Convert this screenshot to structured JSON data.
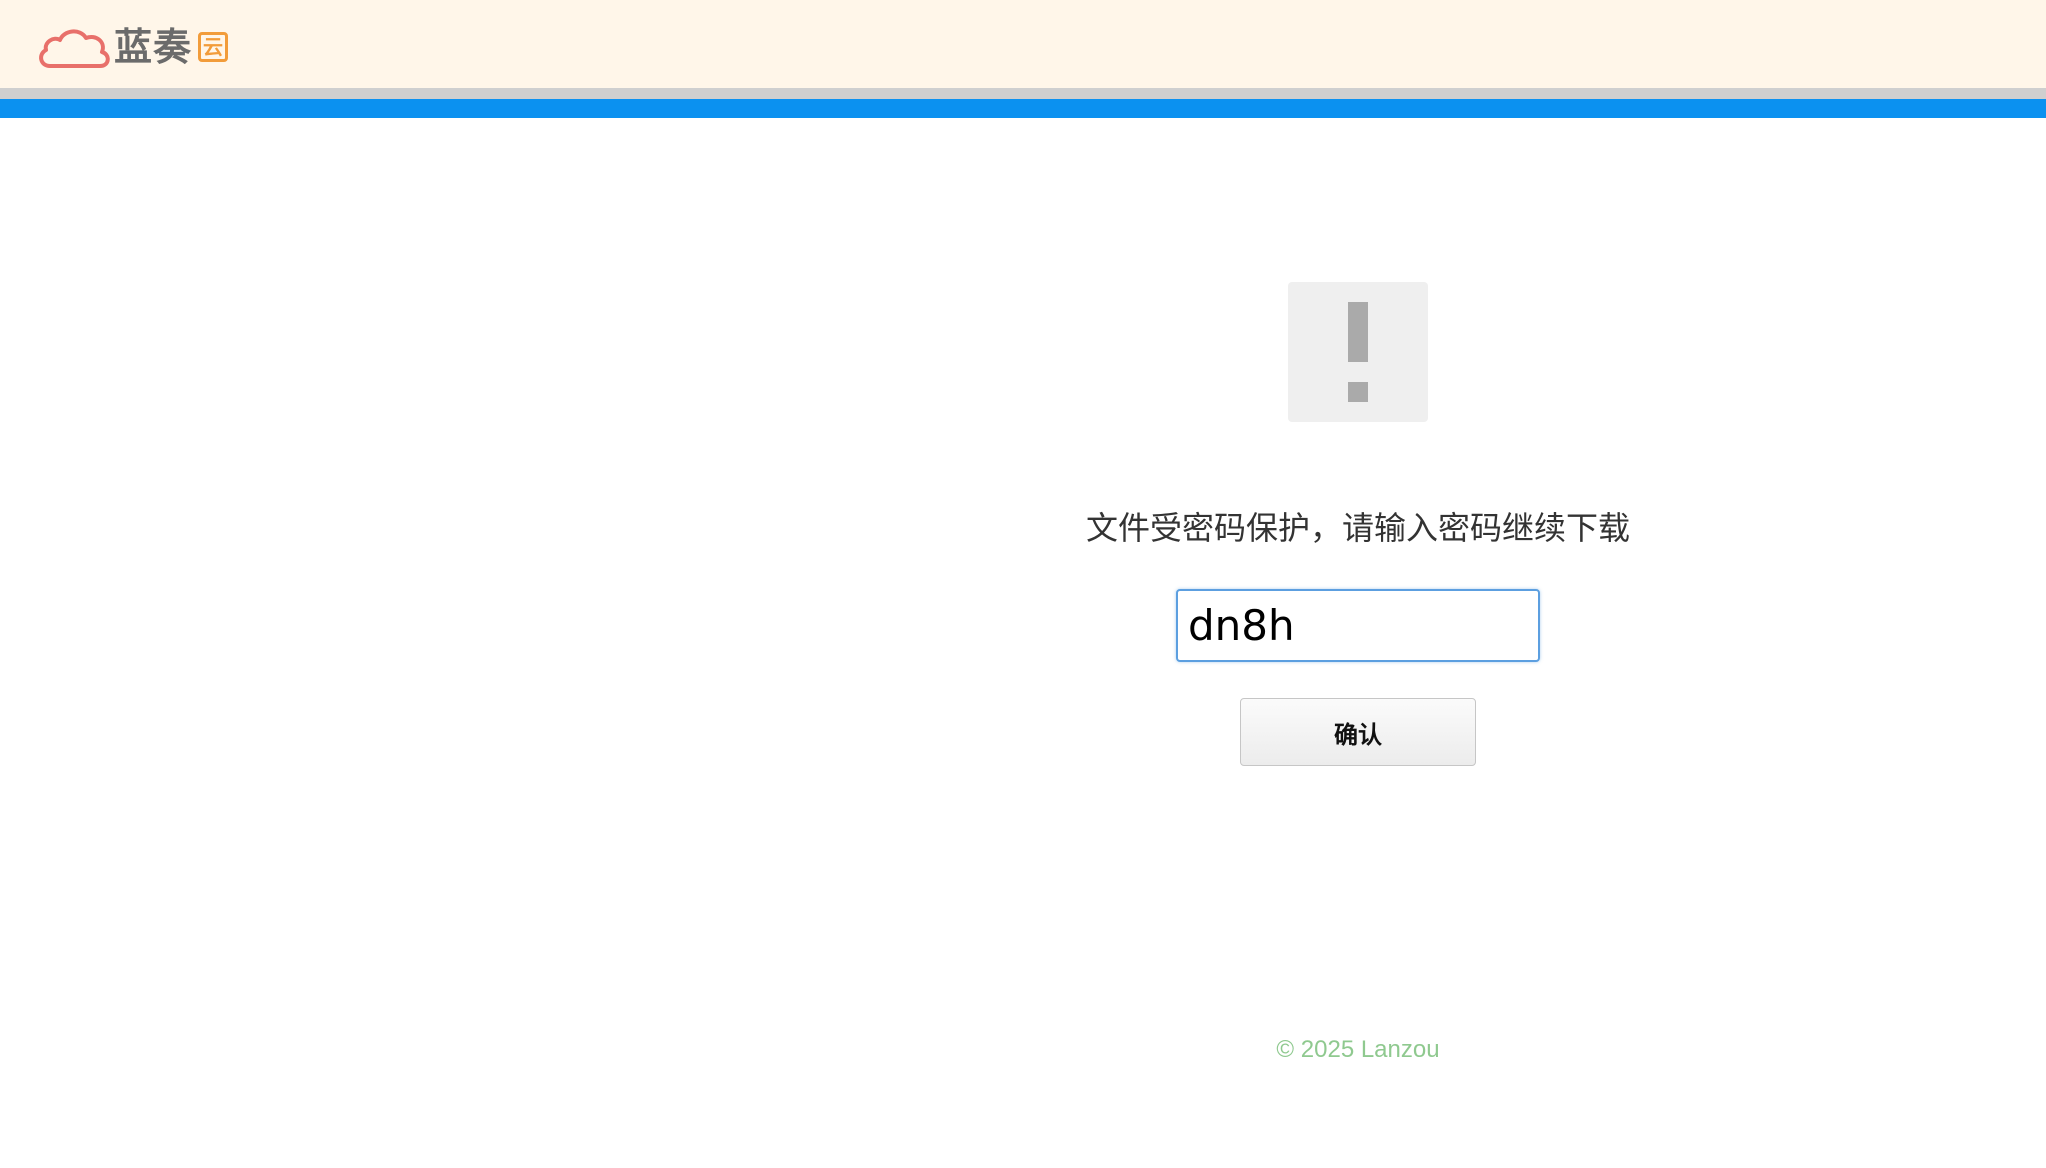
{
  "header": {
    "logo_text": "蓝奏",
    "logo_badge": "云",
    "cloud_icon": "cloud-icon"
  },
  "main": {
    "alert_icon": "exclamation-icon",
    "prompt": "文件受密码保护，请输入密码继续下载",
    "password_value": "dn8h",
    "confirm_label": "确认"
  },
  "footer": {
    "copyright": "© 2025 Lanzou"
  },
  "colors": {
    "header_bg": "#fff6e9",
    "accent_bar": "#0b91f0",
    "logo_cloud": "#e8706a",
    "logo_badge": "#f29c3a",
    "footer_text": "#8fc98f"
  }
}
